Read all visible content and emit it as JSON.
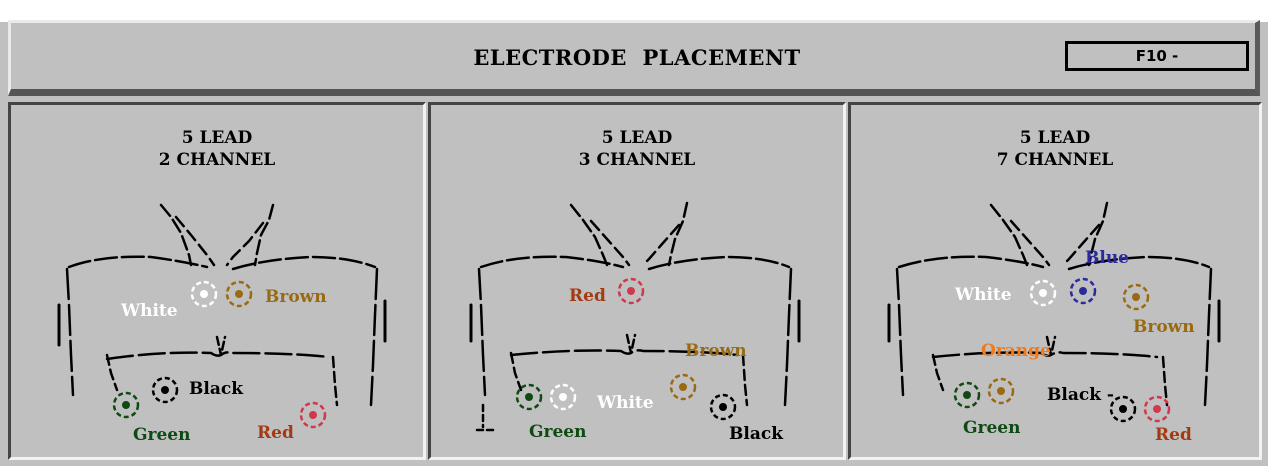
{
  "header": {
    "title": "ELECTRODE  PLACEMENT",
    "function_key": "F10 -"
  },
  "colors": {
    "white": "#ffffff",
    "brown": "#9a6a12",
    "black": "#000000",
    "green": "#0e4a12",
    "red": "#a33a12",
    "blue": "#2b2b9c",
    "orange": "#f07a1a",
    "panel_bg": "#c0c0c0"
  },
  "panels": [
    {
      "line1": "5 LEAD",
      "line2": "2 CHANNEL",
      "labels": {
        "white": "White",
        "brown": "Brown",
        "black": "Black",
        "green": "Green",
        "red": "Red"
      }
    },
    {
      "line1": "5 LEAD",
      "line2": "3 CHANNEL",
      "labels": {
        "red": "Red",
        "brown": "Brown",
        "white": "White",
        "green": "Green",
        "black": "Black"
      }
    },
    {
      "line1": "5 LEAD",
      "line2": "7 CHANNEL",
      "labels": {
        "blue": "Blue",
        "white": "White",
        "brown": "Brown",
        "orange": "Orange",
        "black": "Black -",
        "green": "Green",
        "red": "Red"
      }
    }
  ]
}
